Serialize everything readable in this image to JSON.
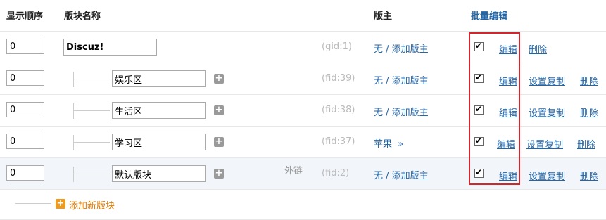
{
  "header": {
    "order": "显示顺序",
    "name": "版块名称",
    "moderator": "版主",
    "batch_edit": "批量编辑"
  },
  "rows": [
    {
      "order": "0",
      "name": "Discuz!",
      "id": "(gid:1)",
      "mod_name": "无",
      "mod_add": "添加版主",
      "edit": "编辑",
      "copy": "",
      "delete": "删除",
      "ext": ""
    },
    {
      "order": "0",
      "name": "娱乐区",
      "id": "(fid:39)",
      "mod_name": "无",
      "mod_add": "添加版主",
      "edit": "编辑",
      "copy": "设置复制",
      "delete": "删除",
      "ext": ""
    },
    {
      "order": "0",
      "name": "生活区",
      "id": "(fid:38)",
      "mod_name": "无",
      "mod_add": "添加版主",
      "edit": "编辑",
      "copy": "设置复制",
      "delete": "删除",
      "ext": ""
    },
    {
      "order": "0",
      "name": "学习区",
      "id": "(fid:37)",
      "mod_name": "苹果",
      "mod_add": "»",
      "edit": "编辑",
      "copy": "设置复制",
      "delete": "删除",
      "ext": ""
    },
    {
      "order": "0",
      "name": "默认版块",
      "id": "(fid:2)",
      "mod_name": "无",
      "mod_add": "添加版主",
      "edit": "编辑",
      "copy": "设置复制",
      "delete": "删除",
      "ext": "外链"
    }
  ],
  "add_new": "添加新版块",
  "colors": {
    "accent": "#2366a8",
    "highlight": "#d8232a",
    "add": "#e07a00"
  }
}
